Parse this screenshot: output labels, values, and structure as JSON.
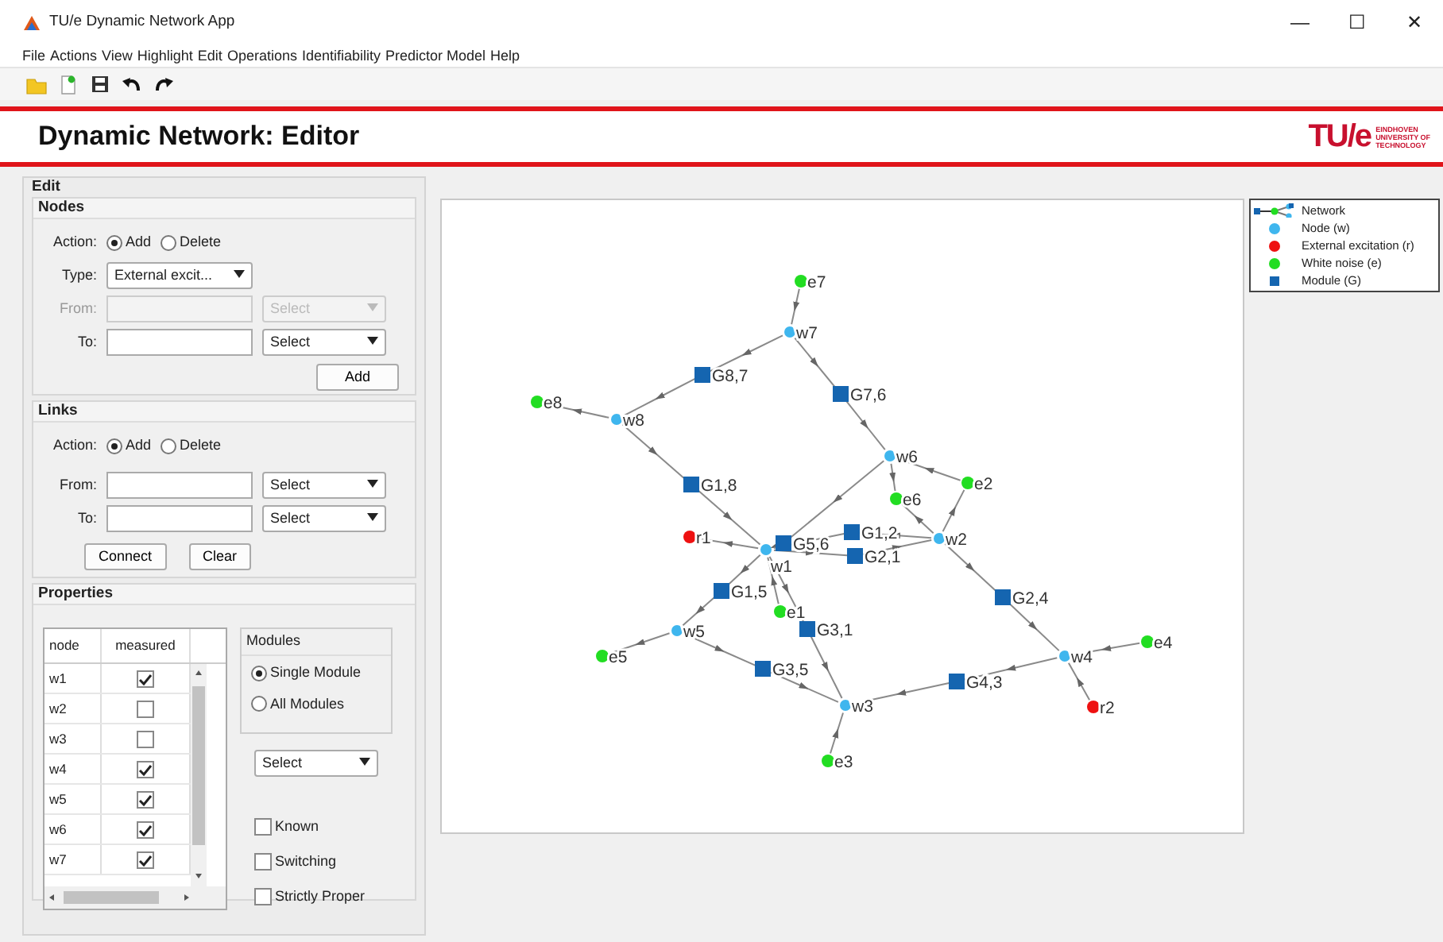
{
  "window": {
    "title": "TU/e Dynamic Network App",
    "controls": [
      "—",
      "☐",
      "✕"
    ]
  },
  "menu": [
    "File",
    "Actions",
    "View",
    "Highlight",
    "Edit",
    "Operations",
    "Identifiability",
    "Predictor Model",
    "Help"
  ],
  "toolbar": [
    {
      "kind": "open"
    },
    {
      "kind": "new"
    },
    {
      "kind": "save"
    },
    {
      "kind": "undo"
    },
    {
      "kind": "redo"
    }
  ],
  "header": {
    "title": "Dynamic Network: Editor",
    "logo": "TU/e",
    "logo_lines": [
      "EINDHOVEN",
      "UNIVERSITY OF",
      "TECHNOLOGY"
    ]
  },
  "edit": {
    "title": "Edit",
    "nodes": {
      "title": "Nodes",
      "action_label": "Action:",
      "actions": [
        {
          "label": "Add",
          "selected": true
        },
        {
          "label": "Delete",
          "selected": false
        }
      ],
      "type_label": "Type:",
      "type_value": "External excit...",
      "from_label": "From:",
      "from_select": "Select",
      "from_disabled": true,
      "to_label": "To:",
      "to_select": "Select",
      "button": "Add"
    },
    "links": {
      "title": "Links",
      "action_label": "Action:",
      "actions": [
        {
          "label": "Add",
          "selected": true
        },
        {
          "label": "Delete",
          "selected": false
        }
      ],
      "from_label": "From:",
      "from_select": "Select",
      "to_label": "To:",
      "to_select": "Select",
      "buttons": [
        "Connect",
        "Clear"
      ]
    },
    "properties": {
      "title": "Properties",
      "table": {
        "columns": [
          "node",
          "measured"
        ],
        "rows": [
          {
            "node": "w1",
            "measured": true
          },
          {
            "node": "w2",
            "measured": false
          },
          {
            "node": "w3",
            "measured": false
          },
          {
            "node": "w4",
            "measured": true
          },
          {
            "node": "w5",
            "measured": true
          },
          {
            "node": "w6",
            "measured": true
          },
          {
            "node": "w7",
            "measured": true
          }
        ]
      },
      "modules": {
        "title": "Modules",
        "options": [
          {
            "label": "Single Module",
            "selected": true
          },
          {
            "label": "All Modules",
            "selected": false
          }
        ]
      },
      "select": "Select",
      "checks": [
        {
          "label": "Known",
          "checked": false
        },
        {
          "label": "Switching",
          "checked": false
        },
        {
          "label": "Strictly Proper",
          "checked": false
        }
      ]
    }
  },
  "legend": {
    "items": [
      {
        "kind": "network",
        "label": "Network"
      },
      {
        "kind": "node",
        "label": "Node (w)",
        "color": "#3fb6ee"
      },
      {
        "kind": "excitation",
        "label": "External excitation (r)",
        "color": "#ee1111"
      },
      {
        "kind": "noise",
        "label": "White noise (e)",
        "color": "#22dd22"
      },
      {
        "kind": "module",
        "label": "Module (G)",
        "color": "#1565b0"
      }
    ]
  },
  "graph": {
    "nodes": [
      {
        "label": "e7",
        "kind": "noise"
      },
      {
        "label": "w7",
        "kind": "node"
      },
      {
        "label": "G8,7",
        "kind": "module"
      },
      {
        "label": "G7,6",
        "kind": "module"
      },
      {
        "label": "e8",
        "kind": "noise"
      },
      {
        "label": "w8",
        "kind": "node"
      },
      {
        "label": "w6",
        "kind": "node"
      },
      {
        "label": "e2",
        "kind": "noise"
      },
      {
        "label": "e6",
        "kind": "noise"
      },
      {
        "label": "G1,8",
        "kind": "module"
      },
      {
        "label": "r1",
        "kind": "excitation"
      },
      {
        "label": "w1",
        "kind": "node"
      },
      {
        "label": "G5,6",
        "kind": "module"
      },
      {
        "label": "G1,2",
        "kind": "module"
      },
      {
        "label": "w2",
        "kind": "node"
      },
      {
        "label": "G2,1",
        "kind": "module"
      },
      {
        "label": "G1,5",
        "kind": "module"
      },
      {
        "label": "e1",
        "kind": "noise"
      },
      {
        "label": "G2,4",
        "kind": "module"
      },
      {
        "label": "w5",
        "kind": "node"
      },
      {
        "label": "G3,1",
        "kind": "module"
      },
      {
        "label": "e5",
        "kind": "noise"
      },
      {
        "label": "G3,5",
        "kind": "module"
      },
      {
        "label": "w4",
        "kind": "node"
      },
      {
        "label": "e4",
        "kind": "noise"
      },
      {
        "label": "G4,3",
        "kind": "module"
      },
      {
        "label": "w3",
        "kind": "node"
      },
      {
        "label": "r2",
        "kind": "excitation"
      },
      {
        "label": "e3",
        "kind": "noise"
      }
    ]
  }
}
